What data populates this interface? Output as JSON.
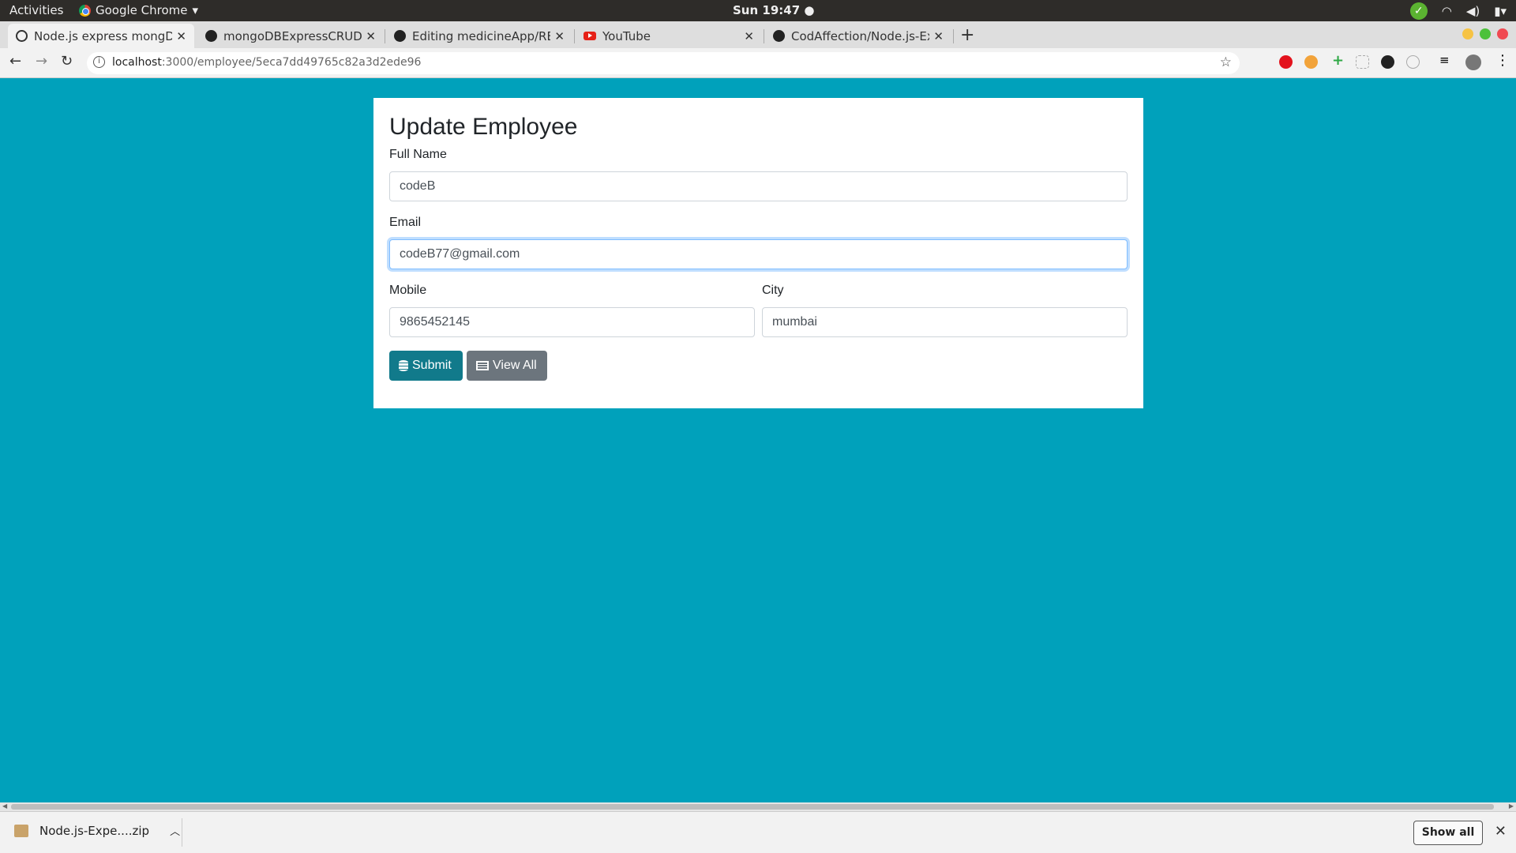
{
  "system": {
    "activities": "Activities",
    "app_name": "Google Chrome",
    "clock": "Sun 19:47 ●"
  },
  "tabs": [
    {
      "title": "Node.js express mongDB",
      "icon": "globe-icon"
    },
    {
      "title": "mongoDBExpressCRUD/",
      "icon": "github-icon"
    },
    {
      "title": "Editing medicineApp/RE",
      "icon": "github-icon"
    },
    {
      "title": "YouTube",
      "icon": "youtube-icon"
    },
    {
      "title": "CodAffection/Node.js-Ex",
      "icon": "github-icon"
    }
  ],
  "address": {
    "host": "localhost",
    "path": ":3000/employee/5eca7dd49765c82a3d2ede96"
  },
  "form": {
    "title": "Update Employee",
    "full_name_label": "Full Name",
    "full_name_value": "codeB",
    "email_label": "Email",
    "email_value": "codeB77@gmail.com",
    "mobile_label": "Mobile",
    "mobile_value": "9865452145",
    "city_label": "City",
    "city_value": "mumbai",
    "submit_label": "Submit",
    "view_all_label": "View All"
  },
  "downloads": {
    "file_name": "Node.js-Expe....zip",
    "show_all": "Show all"
  },
  "colors": {
    "page_background": "#00a1bb",
    "primary_button": "#117a8b",
    "secondary_button": "#6c757d"
  }
}
